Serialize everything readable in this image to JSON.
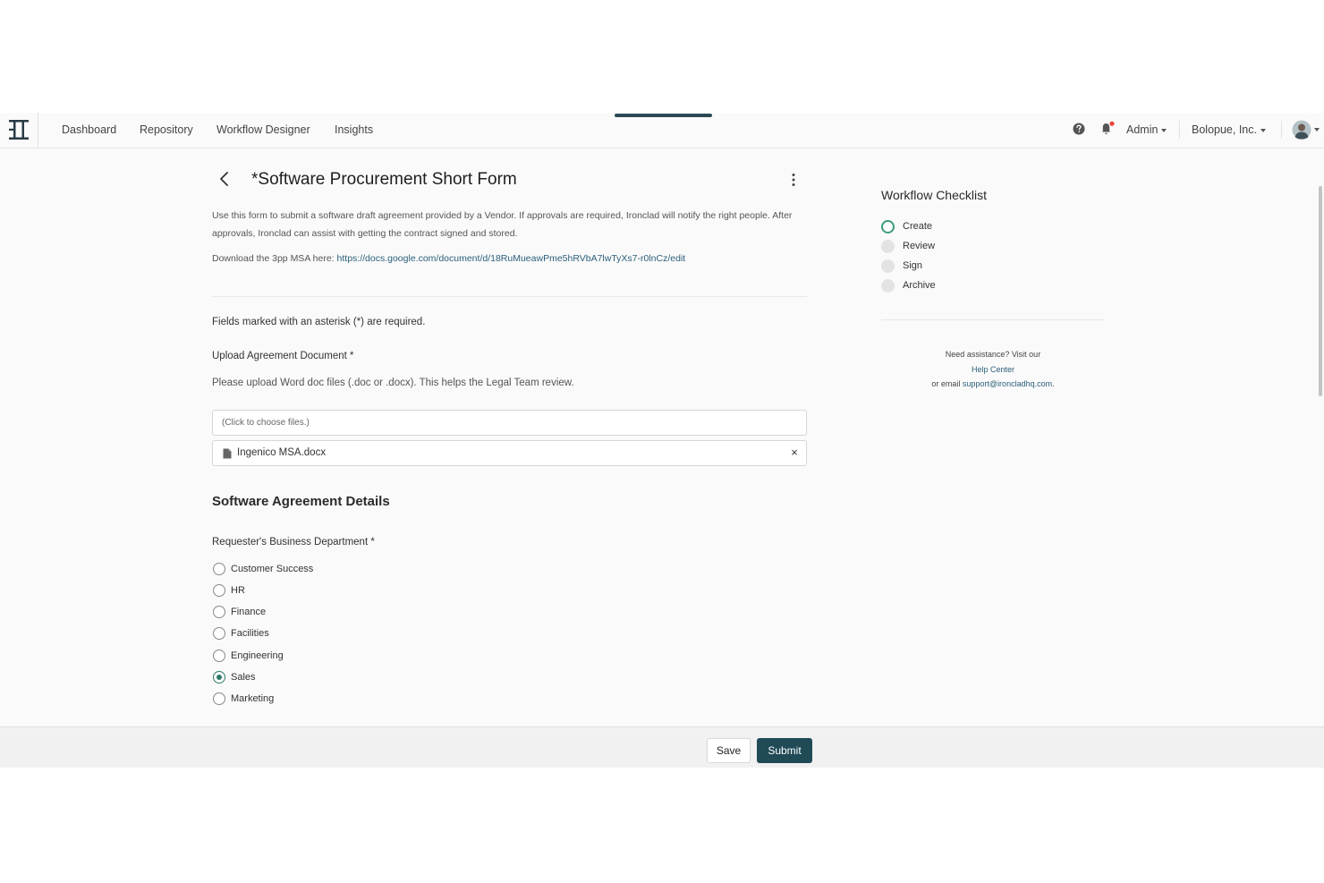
{
  "nav": {
    "links": [
      "Dashboard",
      "Repository",
      "Workflow Designer",
      "Insights"
    ],
    "admin_label": "Admin",
    "org_label": "Bolopue, Inc."
  },
  "form": {
    "title": "*Software Procurement Short Form",
    "description": "Use this form to submit a software draft agreement provided by a Vendor. If approvals are required, Ironclad will notify the right people. After approvals, Ironclad can assist with getting the contract signed and stored.",
    "download_prefix": "Download the 3pp MSA here: ",
    "download_link": "https://docs.google.com/document/d/18RuMueawPme5hRVbA7lwTyXs7-r0lnCz/edit",
    "required_note": "Fields marked with an asterisk (*) are required.",
    "upload_label": "Upload Agreement Document *",
    "upload_help": "Please upload Word doc files (.doc or .docx). This helps the Legal Team review.",
    "file_picker_placeholder": "(Click to choose files.)",
    "uploaded_file": "Ingenico MSA.docx",
    "remove_symbol": "×",
    "section_title": "Software Agreement Details",
    "department_label": "Requester's Business Department *",
    "departments": [
      "Customer Success",
      "HR",
      "Finance",
      "Facilities",
      "Engineering",
      "Sales",
      "Marketing"
    ],
    "selected_department": "Sales"
  },
  "checklist": {
    "title": "Workflow Checklist",
    "steps": [
      "Create",
      "Review",
      "Sign",
      "Archive"
    ],
    "active_step": "Create",
    "assist_line1": "Need assistance? Visit our",
    "help_center": "Help Center",
    "assist_email_prefix": "or email ",
    "support_email": "support@ironcladhq.com",
    "assist_email_suffix": "."
  },
  "footer": {
    "save_label": "Save",
    "submit_label": "Submit"
  },
  "colors": {
    "primary": "#1f4a56",
    "accent_green": "#3c9a7e",
    "link": "#2b5f7a",
    "notification_dot": "#e8453c"
  }
}
